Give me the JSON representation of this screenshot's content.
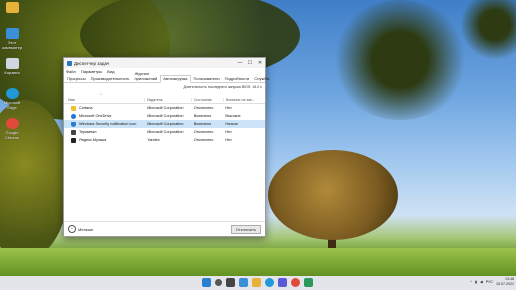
{
  "desktop": {
    "icons": [
      {
        "label": "",
        "name": "folder-icon",
        "color": "#e8b23a"
      },
      {
        "label": "Этот компьютер",
        "name": "computer-icon",
        "color": "#3a8fd6"
      },
      {
        "label": "Корзина",
        "name": "recycle-bin-icon",
        "color": "#cfd8e0"
      },
      {
        "label": "Microsoft Edge",
        "name": "edge-icon",
        "color": "#1f9ad6"
      },
      {
        "label": "Google Chrome",
        "name": "chrome-icon",
        "color": "#e04a3a"
      }
    ]
  },
  "window": {
    "title": "Диспетчер задач",
    "controls": {
      "minimize": "—",
      "maximize": "☐",
      "close": "✕"
    },
    "menu": [
      "Файл",
      "Параметры",
      "Вид"
    ],
    "tabs": [
      "Процессы",
      "Производительность",
      "Журнал приложений",
      "Автозагрузка",
      "Пользователи",
      "Подробности",
      "Службы"
    ],
    "active_tab": "Автозагрузка",
    "bios_time": "Длительность последнего запуска BIOS:  16.0 с",
    "columns": {
      "name": "Имя",
      "publisher": "Издатель",
      "status": "Состояние",
      "impact": "Влияние на зап..."
    },
    "rows": [
      {
        "name": "Cortana",
        "publisher": "Microsoft Corporation",
        "status": "Отключено",
        "impact": "Нет",
        "icon_color": "#f2c230",
        "selected": false
      },
      {
        "name": "Microsoft OneDrive",
        "publisher": "Microsoft Corporation",
        "status": "Включено",
        "impact": "Высокое",
        "icon_color": "#1e78d6",
        "selected": false
      },
      {
        "name": "Windows Security notification icon",
        "publisher": "Microsoft Corporation",
        "status": "Включено",
        "impact": "Низкое",
        "icon_color": "#2a7fd0",
        "selected": true
      },
      {
        "name": "Терминал",
        "publisher": "Microsoft Corporation",
        "status": "Отключено",
        "impact": "Нет",
        "icon_color": "#444444",
        "selected": false
      },
      {
        "name": "Яндекс.Музыка",
        "publisher": "Yandex",
        "status": "Отключено",
        "impact": "Нет",
        "icon_color": "#222222",
        "selected": false
      }
    ],
    "footer": {
      "less_label": "Меньше",
      "disable_label": "Отключить"
    }
  },
  "taskbar": {
    "icons": [
      {
        "name": "start-icon",
        "color": "#2a7fd0"
      },
      {
        "name": "search-icon",
        "color": "#555555"
      },
      {
        "name": "task-view-icon",
        "color": "#444444"
      },
      {
        "name": "widgets-icon",
        "color": "#3a8fd6"
      },
      {
        "name": "file-explorer-icon",
        "color": "#e8b23a"
      },
      {
        "name": "edge-icon",
        "color": "#1f9ad6"
      },
      {
        "name": "store-icon",
        "color": "#5a5ad6"
      },
      {
        "name": "chrome-icon",
        "color": "#e04a3a"
      },
      {
        "name": "task-manager-icon",
        "color": "#2b9a5a"
      }
    ],
    "tray": {
      "language": "РУС",
      "time": "13:48",
      "date": "15.07.2021"
    }
  }
}
